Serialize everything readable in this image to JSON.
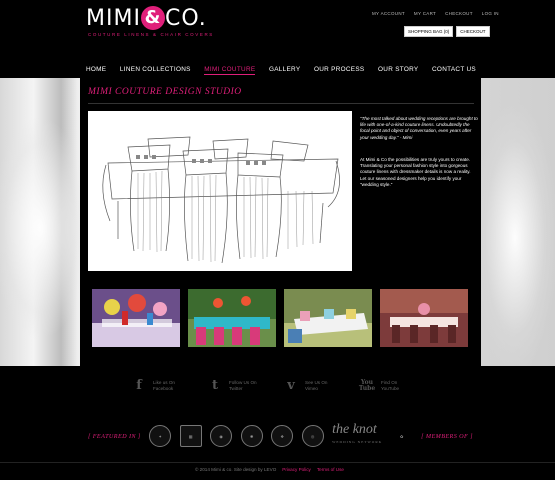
{
  "brand": {
    "logo_left": "MIMI",
    "logo_amp": "&",
    "logo_right": "CO.",
    "tagline": "COUTURE LINENS & CHAIR COVERS",
    "accent_color": "#e01f7a"
  },
  "utility": {
    "links": [
      "MY ACCOUNT",
      "MY CART",
      "CHECKOUT",
      "LOG IN"
    ],
    "shopping_bag": "SHOPPING BAG (0)",
    "checkout": "CHECKOUT"
  },
  "nav": {
    "items": [
      "HOME",
      "LINEN COLLECTIONS",
      "MIMI COUTURE",
      "GALLERY",
      "OUR PROCESS",
      "OUR STORY",
      "CONTACT US"
    ],
    "active_index": 2
  },
  "main": {
    "title": "MIMI COUTURE  DESIGN STUDIO",
    "quote": "\"The most talked about wedding receptions are brought to life with one-of-a-kind couture linens. Undoubtedly the focal point and object of conversation, even years after your wedding day.\" - Mimi",
    "body": "At Mimi & Co the possibilities are truly yours to create. Translating your personal fashion style into gorgeous couture linens with dressmaker details is now a reality. Let our seasoned designers help you identify your \"wedding style.\""
  },
  "social": [
    {
      "icon": "facebook-icon",
      "glyph": "f",
      "line1": "Like us On",
      "line2": "Facebook"
    },
    {
      "icon": "twitter-icon",
      "glyph": "t",
      "line1": "Follow Us On",
      "line2": "Twitter"
    },
    {
      "icon": "vimeo-icon",
      "glyph": "v",
      "line1": "See Us On",
      "line2": "Vimeo"
    },
    {
      "icon": "youtube-icon",
      "glyph": "You Tube",
      "line1": "Find On",
      "line2": "YouTube"
    }
  ],
  "featured": {
    "featured_label": "[ FEATURED IN ]",
    "members_label": "[ MEMBERS OF ]",
    "knot_name": "the knot",
    "knot_sub": "WEDDING NETWORK"
  },
  "footer": {
    "copyright": "© 2014 Mimi & co. Site design by LEVO",
    "privacy": "Privacy Policy",
    "terms": "Terms of Use"
  }
}
